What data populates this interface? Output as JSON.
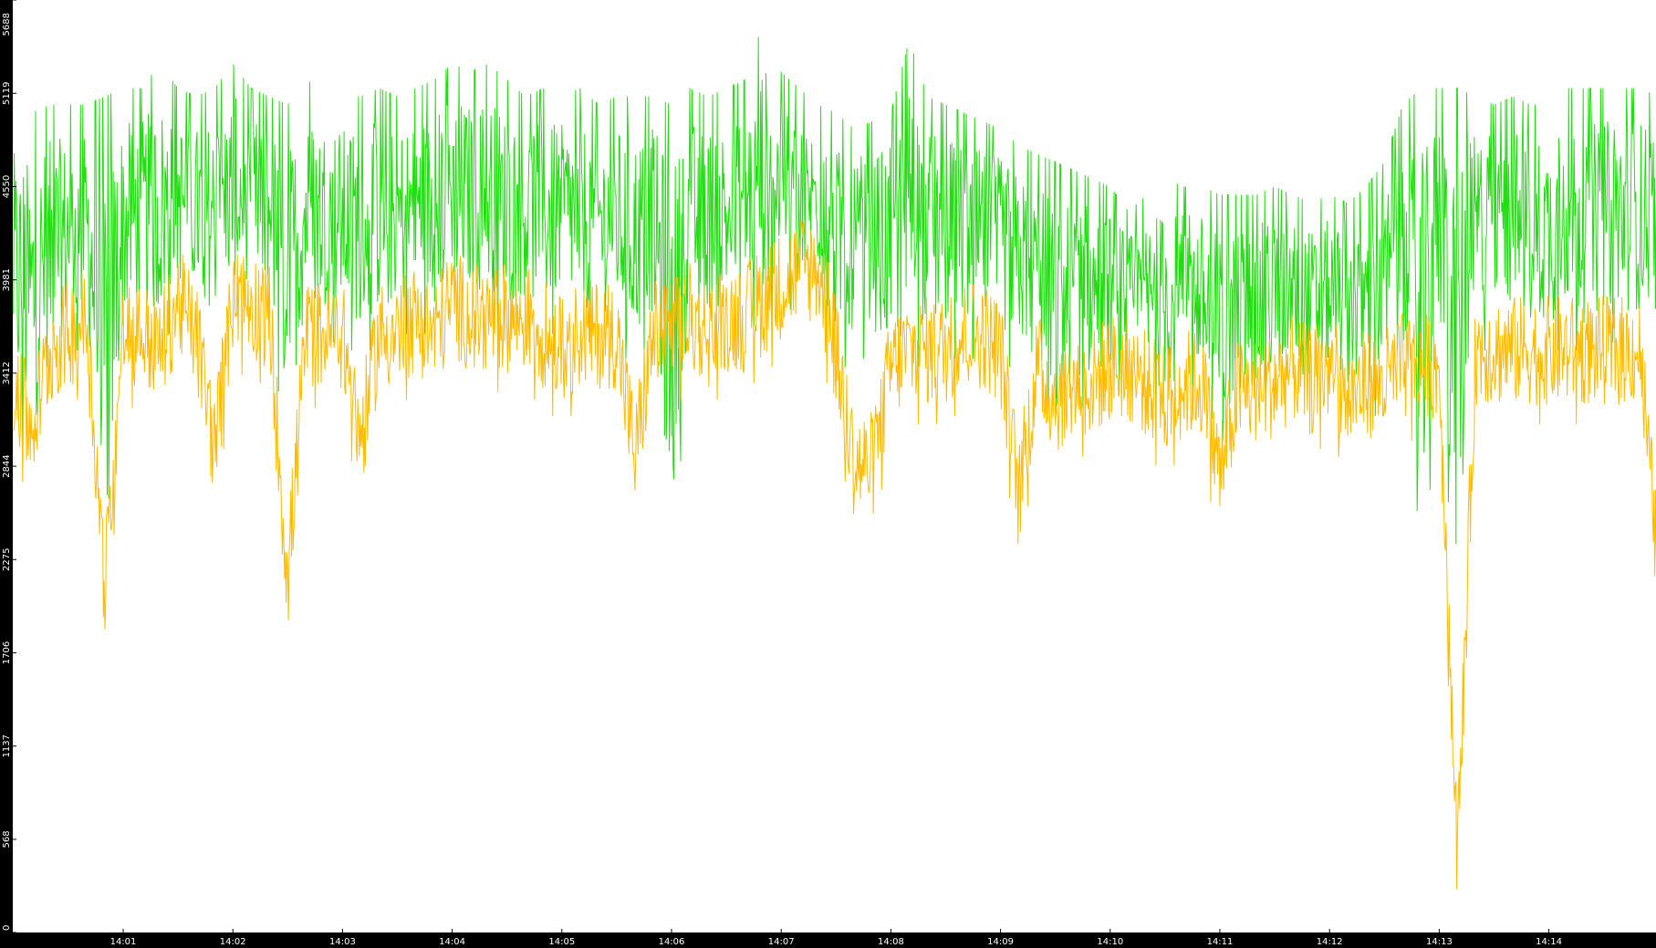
{
  "chart_data": {
    "type": "line",
    "title": "",
    "xlabel": "",
    "ylabel": "",
    "ylim": [
      0,
      5688
    ],
    "xlim": [
      "14:00:00",
      "14:15:10"
    ],
    "grid": false,
    "legend": "none",
    "background_color": "#ffffff",
    "axis_color": "#000000",
    "axis_text_color": "#ffffff",
    "y_ticks": [
      {
        "value": 0,
        "label": "0"
      },
      {
        "value": 568,
        "label": "568"
      },
      {
        "value": 1137,
        "label": "1137"
      },
      {
        "value": 1706,
        "label": "1706"
      },
      {
        "value": 2275,
        "label": "2275"
      },
      {
        "value": 2844,
        "label": "2844"
      },
      {
        "value": 3412,
        "label": "3412"
      },
      {
        "value": 3981,
        "label": "3981"
      },
      {
        "value": 4550,
        "label": "4550"
      },
      {
        "value": 5119,
        "label": "5119"
      },
      {
        "value": 5688,
        "label": "5688"
      }
    ],
    "x_ticks": [
      {
        "value": "14:01:00",
        "label": "14:01"
      },
      {
        "value": "14:02:00",
        "label": "14:02"
      },
      {
        "value": "14:03:00",
        "label": "14:03"
      },
      {
        "value": "14:04:00",
        "label": "14:04"
      },
      {
        "value": "14:05:00",
        "label": "14:05"
      },
      {
        "value": "14:06:00",
        "label": "14:06"
      },
      {
        "value": "14:07:00",
        "label": "14:07"
      },
      {
        "value": "14:08:00",
        "label": "14:08"
      },
      {
        "value": "14:09:00",
        "label": "14:09"
      },
      {
        "value": "14:10:00",
        "label": "14:10"
      },
      {
        "value": "14:11:00",
        "label": "14:11"
      },
      {
        "value": "14:12:00",
        "label": "14:12"
      },
      {
        "value": "14:13:00",
        "label": "14:13"
      },
      {
        "value": "14:14:00",
        "label": "14:14"
      }
    ],
    "series": [
      {
        "color": "#22dd11",
        "x": [
          "14:00:00",
          "14:00:10",
          "14:00:20",
          "14:00:30",
          "14:00:40",
          "14:00:50",
          "14:01:00",
          "14:01:10",
          "14:01:20",
          "14:01:30",
          "14:01:40",
          "14:01:50",
          "14:02:00",
          "14:02:10",
          "14:02:20",
          "14:02:30",
          "14:02:40",
          "14:02:50",
          "14:03:00",
          "14:03:10",
          "14:03:20",
          "14:03:30",
          "14:03:40",
          "14:03:50",
          "14:04:00",
          "14:04:10",
          "14:04:20",
          "14:04:30",
          "14:04:40",
          "14:04:50",
          "14:05:00",
          "14:05:10",
          "14:05:20",
          "14:05:30",
          "14:05:40",
          "14:05:50",
          "14:06:00",
          "14:06:10",
          "14:06:20",
          "14:06:30",
          "14:06:40",
          "14:06:50",
          "14:07:00",
          "14:07:10",
          "14:07:20",
          "14:07:30",
          "14:07:40",
          "14:07:50",
          "14:08:00",
          "14:08:10",
          "14:08:20",
          "14:08:30",
          "14:08:40",
          "14:08:50",
          "14:09:00",
          "14:09:10",
          "14:09:20",
          "14:09:30",
          "14:09:40",
          "14:09:50",
          "14:10:00",
          "14:10:10",
          "14:10:20",
          "14:10:30",
          "14:10:40",
          "14:10:50",
          "14:11:00",
          "14:11:10",
          "14:11:20",
          "14:11:30",
          "14:11:40",
          "14:11:50",
          "14:12:00",
          "14:12:10",
          "14:12:20",
          "14:12:30",
          "14:12:40",
          "14:12:50",
          "14:13:00",
          "14:13:10",
          "14:13:20",
          "14:13:30",
          "14:13:40",
          "14:13:50",
          "14:14:00",
          "14:14:10",
          "14:14:20",
          "14:14:30",
          "14:14:40",
          "14:14:50",
          "14:15:00",
          "14:15:10"
        ],
        "min": [
          3100,
          2700,
          3300,
          3500,
          3600,
          1900,
          3500,
          3600,
          3500,
          3800,
          3700,
          3600,
          3800,
          3800,
          3700,
          2900,
          3600,
          3600,
          3600,
          3500,
          3600,
          3600,
          3700,
          3600,
          3800,
          3700,
          3700,
          3600,
          3700,
          3600,
          3700,
          3600,
          3600,
          3600,
          3400,
          3600,
          2150,
          3600,
          3600,
          3600,
          3700,
          3700,
          3800,
          3800,
          3900,
          3400,
          3500,
          3500,
          3300,
          3400,
          3500,
          3500,
          3500,
          3500,
          3500,
          3400,
          3300,
          2800,
          3200,
          3200,
          3300,
          3300,
          3200,
          3100,
          3200,
          3200,
          2700,
          3100,
          3100,
          3200,
          3300,
          3200,
          3300,
          3200,
          3100,
          3200,
          3300,
          1900,
          3500,
          1750,
          3500,
          3600,
          3600,
          3500,
          3500,
          3600,
          3500,
          3600,
          3600,
          3600,
          3600,
          1800
        ],
        "max": [
          5000,
          5000,
          5050,
          5050,
          5050,
          5100,
          5150,
          5150,
          5300,
          5150,
          5100,
          5150,
          5300,
          5150,
          5100,
          5050,
          5200,
          5150,
          5100,
          5100,
          5150,
          5100,
          5150,
          5200,
          5300,
          5250,
          5300,
          5200,
          5100,
          5150,
          5100,
          5150,
          5050,
          5100,
          5100,
          5100,
          5050,
          5150,
          5100,
          5150,
          5200,
          5550,
          5250,
          5150,
          5050,
          5000,
          4900,
          4950,
          5000,
          5450,
          5100,
          5050,
          5000,
          4950,
          4900,
          4800,
          4750,
          4700,
          4650,
          4600,
          4550,
          4400,
          4500,
          4600,
          4550,
          4550,
          4500,
          4500,
          4500,
          4550,
          4500,
          4450,
          4500,
          4450,
          4550,
          4700,
          5050,
          5150,
          5150,
          5150,
          5100,
          5050,
          5100,
          5050,
          5050,
          5150,
          5150,
          5150,
          5150,
          5150,
          5100,
          4900
        ]
      },
      {
        "color": "#ffbb00",
        "x": [
          "14:00:00",
          "14:00:10",
          "14:00:20",
          "14:00:30",
          "14:00:40",
          "14:00:50",
          "14:01:00",
          "14:01:10",
          "14:01:20",
          "14:01:30",
          "14:01:40",
          "14:01:50",
          "14:02:00",
          "14:02:10",
          "14:02:20",
          "14:02:30",
          "14:02:40",
          "14:02:50",
          "14:03:00",
          "14:03:10",
          "14:03:20",
          "14:03:30",
          "14:03:40",
          "14:03:50",
          "14:04:00",
          "14:04:10",
          "14:04:20",
          "14:04:30",
          "14:04:40",
          "14:04:50",
          "14:05:00",
          "14:05:10",
          "14:05:20",
          "14:05:30",
          "14:05:40",
          "14:05:50",
          "14:06:00",
          "14:06:10",
          "14:06:20",
          "14:06:30",
          "14:06:40",
          "14:06:50",
          "14:07:00",
          "14:07:10",
          "14:07:20",
          "14:07:30",
          "14:07:40",
          "14:07:50",
          "14:08:00",
          "14:08:10",
          "14:08:20",
          "14:08:30",
          "14:08:40",
          "14:08:50",
          "14:09:00",
          "14:09:10",
          "14:09:20",
          "14:09:30",
          "14:09:40",
          "14:09:50",
          "14:10:00",
          "14:10:10",
          "14:10:20",
          "14:10:30",
          "14:10:40",
          "14:10:50",
          "14:11:00",
          "14:11:10",
          "14:11:20",
          "14:11:30",
          "14:11:40",
          "14:11:50",
          "14:12:00",
          "14:12:10",
          "14:12:20",
          "14:12:30",
          "14:12:40",
          "14:12:50",
          "14:13:00",
          "14:13:10",
          "14:13:20",
          "14:13:30",
          "14:13:40",
          "14:13:50",
          "14:14:00",
          "14:14:10",
          "14:14:20",
          "14:14:30",
          "14:14:40",
          "14:14:50",
          "14:15:00",
          "14:15:10"
        ],
        "min": [
          2900,
          2600,
          3100,
          3200,
          3300,
          1650,
          3200,
          3200,
          3100,
          3400,
          3200,
          2500,
          3400,
          3400,
          3300,
          1700,
          3200,
          3200,
          3200,
          2550,
          3200,
          3200,
          3300,
          3200,
          3400,
          3300,
          3300,
          3300,
          3300,
          3200,
          3100,
          3200,
          3200,
          3200,
          2450,
          3200,
          3200,
          3300,
          3200,
          3300,
          3300,
          3400,
          3500,
          3600,
          3600,
          3100,
          2400,
          2400,
          3000,
          3100,
          3100,
          3100,
          3200,
          3200,
          3100,
          2200,
          3000,
          2800,
          2900,
          2900,
          3000,
          3000,
          2900,
          2800,
          2900,
          2900,
          2350,
          2850,
          2850,
          2900,
          3000,
          2900,
          3000,
          2800,
          2900,
          2900,
          3000,
          3000,
          3000,
          0,
          3100,
          3100,
          3100,
          3100,
          3100,
          3100,
          3100,
          3100,
          3100,
          3100,
          1700,
          1650
        ]
      }
    ]
  }
}
